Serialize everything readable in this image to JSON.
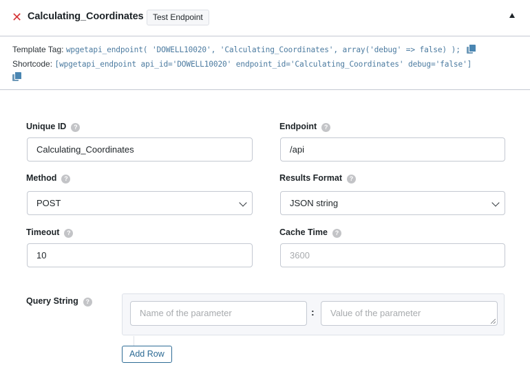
{
  "header": {
    "close_icon": "close-icon",
    "title": "Calculating_Coordinates",
    "test_button_label": "Test Endpoint",
    "toggle_icon": "triangle-up-icon"
  },
  "tags": {
    "template_tag_label": "Template Tag:",
    "template_tag_code": "wpgetapi_endpoint( 'DOWELL10020', 'Calculating_Coordinates', array('debug' => false) );",
    "shortcode_label": "Shortcode:",
    "shortcode_code": "[wpgetapi_endpoint api_id='DOWELL10020' endpoint_id='Calculating_Coordinates' debug='false']",
    "copy_icon": "copy-icon",
    "help_glyph": "?"
  },
  "fields": {
    "unique_id": {
      "label": "Unique ID",
      "value": "Calculating_Coordinates"
    },
    "endpoint": {
      "label": "Endpoint",
      "value": "/api"
    },
    "method": {
      "label": "Method",
      "value": "POST"
    },
    "results_format": {
      "label": "Results Format",
      "value": "JSON string"
    },
    "timeout": {
      "label": "Timeout",
      "value": "10"
    },
    "cache_time": {
      "label": "Cache Time",
      "value": "",
      "placeholder": "3600"
    },
    "query_string": {
      "label": "Query String",
      "name_placeholder": "Name of the parameter",
      "separator": ":",
      "value_placeholder": "Value of the parameter",
      "add_row_label": "Add Row"
    }
  },
  "colors": {
    "close": "#d63638",
    "code": "#4c7ba0",
    "button_accent": "#2c6a94",
    "border": "#c3c8d1"
  }
}
